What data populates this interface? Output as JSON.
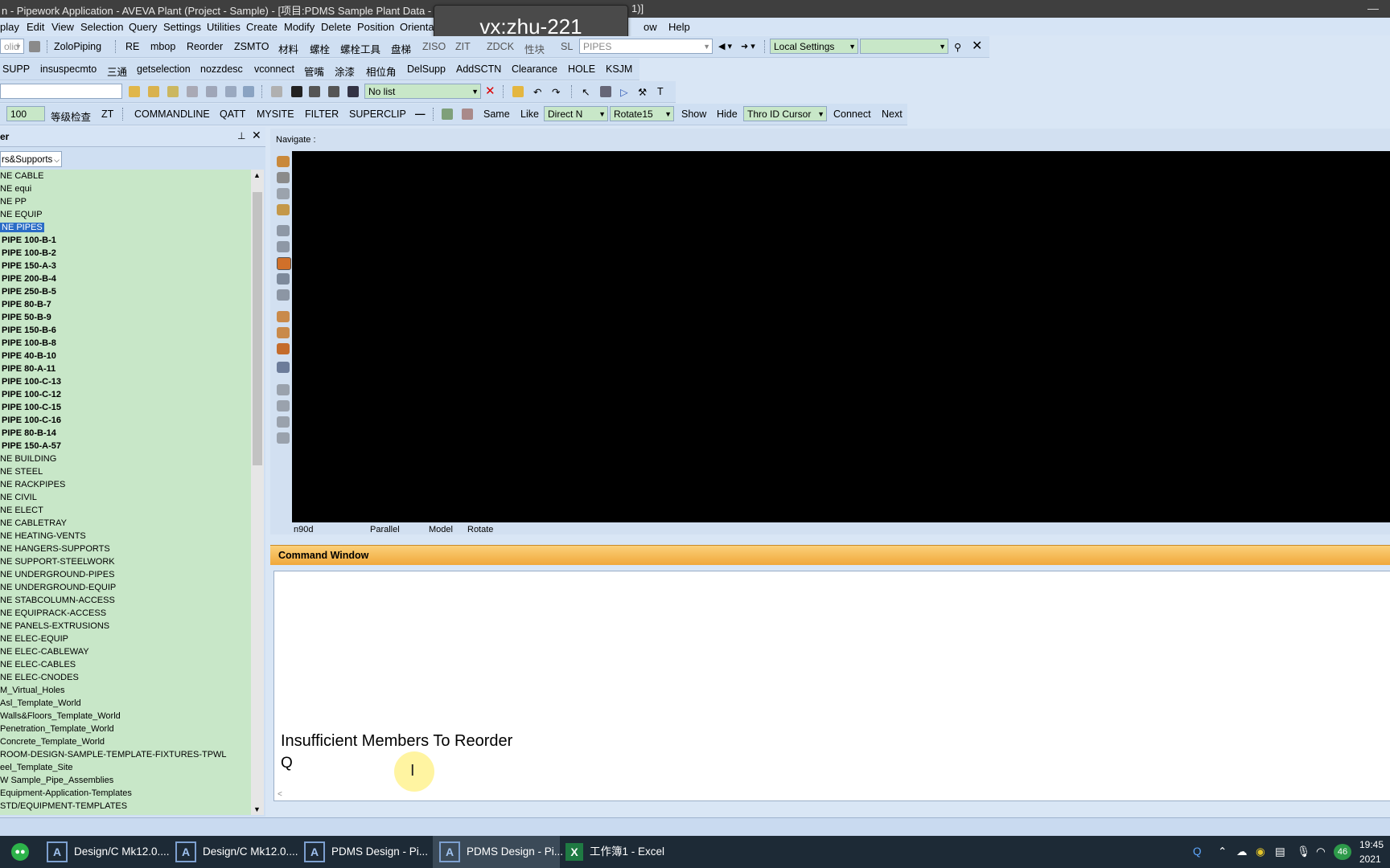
{
  "window": {
    "title": "n - Pipework Application -  AVEVA Plant (Project - Sample) - [项目:PDMS Sample Plant Data - ",
    "title_tail": "1)]",
    "minimize_glyph": "—"
  },
  "overlay": {
    "text": "vx:zhu-221"
  },
  "menu": {
    "items": [
      "play",
      "Edit",
      "View",
      "Selection",
      "Query",
      "Settings",
      "Utilities",
      "Create",
      "Modify",
      "Delete",
      "Position",
      "Orienta",
      "ow",
      "Help"
    ]
  },
  "toolbar1": {
    "left_combo": "olid",
    "buttons": [
      "ZoloPiping",
      "RE",
      "mbop",
      "Reorder",
      "ZSMTO",
      "材料",
      "螺栓",
      "螺栓工具",
      "盘梯",
      "ZISO",
      "ZIT",
      "ZDCK",
      "性块",
      "SL"
    ],
    "pipe_combo": "PIPES",
    "settings_combo": "Local Settings",
    "blank_combo": ""
  },
  "toolbar2": {
    "buttons": [
      "SUPP",
      "insuspecmto",
      "三通",
      "getselection",
      "nozzdesc",
      "vconnect",
      "管嘴",
      "涂漆",
      "相位角",
      "DelSupp",
      "AddSCTN",
      "Clearance",
      "HOLE",
      "KSJM"
    ]
  },
  "toolbar3": {
    "list_combo": "No list"
  },
  "toolbar4": {
    "value_field": "100",
    "buttons": [
      "等级检查",
      "ZT",
      "COMMANDLINE",
      "QATT",
      "MYSITE",
      "FILTER",
      "SUPERCLIP",
      "—",
      "Same",
      "Like"
    ],
    "direct_combo": "Direct N",
    "rotate_combo": "Rotate15",
    "buttons2": [
      "Show",
      "Hide"
    ],
    "cursor_combo": "Thro ID Cursor",
    "buttons3": [
      "Connect",
      "Next"
    ]
  },
  "explorer": {
    "title": "er",
    "filter_value": "rs&Supports",
    "items": [
      {
        "label": "NE CABLE",
        "bold": false,
        "selected": false
      },
      {
        "label": "NE equi",
        "bold": false,
        "selected": false
      },
      {
        "label": "NE PP",
        "bold": false,
        "selected": false
      },
      {
        "label": "NE EQUIP",
        "bold": false,
        "selected": false
      },
      {
        "label": "NE PIPES",
        "bold": false,
        "selected": true
      },
      {
        "label": "PIPE 100-B-1",
        "bold": true,
        "selected": false
      },
      {
        "label": "PIPE 100-B-2",
        "bold": true,
        "selected": false
      },
      {
        "label": "PIPE 150-A-3",
        "bold": true,
        "selected": false
      },
      {
        "label": "PIPE 200-B-4",
        "bold": true,
        "selected": false
      },
      {
        "label": "PIPE 250-B-5",
        "bold": true,
        "selected": false
      },
      {
        "label": "PIPE 80-B-7",
        "bold": true,
        "selected": false
      },
      {
        "label": "PIPE 50-B-9",
        "bold": true,
        "selected": false
      },
      {
        "label": "PIPE 150-B-6",
        "bold": true,
        "selected": false
      },
      {
        "label": "PIPE 100-B-8",
        "bold": true,
        "selected": false
      },
      {
        "label": "PIPE 40-B-10",
        "bold": true,
        "selected": false
      },
      {
        "label": "PIPE 80-A-11",
        "bold": true,
        "selected": false
      },
      {
        "label": "PIPE 100-C-13",
        "bold": true,
        "selected": false
      },
      {
        "label": "PIPE 100-C-12",
        "bold": true,
        "selected": false
      },
      {
        "label": "PIPE 100-C-15",
        "bold": true,
        "selected": false
      },
      {
        "label": "PIPE 100-C-16",
        "bold": true,
        "selected": false
      },
      {
        "label": "PIPE 80-B-14",
        "bold": true,
        "selected": false
      },
      {
        "label": "PIPE 150-A-57",
        "bold": true,
        "selected": false
      },
      {
        "label": "NE BUILDING",
        "bold": false,
        "selected": false
      },
      {
        "label": "NE STEEL",
        "bold": false,
        "selected": false
      },
      {
        "label": "NE RACKPIPES",
        "bold": false,
        "selected": false
      },
      {
        "label": "NE CIVIL",
        "bold": false,
        "selected": false
      },
      {
        "label": "NE ELECT",
        "bold": false,
        "selected": false
      },
      {
        "label": "NE CABLETRAY",
        "bold": false,
        "selected": false
      },
      {
        "label": "NE HEATING-VENTS",
        "bold": false,
        "selected": false
      },
      {
        "label": "NE HANGERS-SUPPORTS",
        "bold": false,
        "selected": false
      },
      {
        "label": "NE SUPPORT-STEELWORK",
        "bold": false,
        "selected": false
      },
      {
        "label": "NE UNDERGROUND-PIPES",
        "bold": false,
        "selected": false
      },
      {
        "label": "NE UNDERGROUND-EQUIP",
        "bold": false,
        "selected": false
      },
      {
        "label": "NE STABCOLUMN-ACCESS",
        "bold": false,
        "selected": false
      },
      {
        "label": "NE EQUIPRACK-ACCESS",
        "bold": false,
        "selected": false
      },
      {
        "label": "NE PANELS-EXTRUSIONS",
        "bold": false,
        "selected": false
      },
      {
        "label": "NE ELEC-EQUIP",
        "bold": false,
        "selected": false
      },
      {
        "label": "NE ELEC-CABLEWAY",
        "bold": false,
        "selected": false
      },
      {
        "label": "NE ELEC-CABLES",
        "bold": false,
        "selected": false
      },
      {
        "label": "NE ELEC-CNODES",
        "bold": false,
        "selected": false
      },
      {
        "label": "M_Virtual_Holes",
        "bold": false,
        "selected": false
      },
      {
        "label": "Asl_Template_World",
        "bold": false,
        "selected": false
      },
      {
        "label": "Walls&Floors_Template_World",
        "bold": false,
        "selected": false
      },
      {
        "label": "Penetration_Template_World",
        "bold": false,
        "selected": false
      },
      {
        "label": "Concrete_Template_World",
        "bold": false,
        "selected": false
      },
      {
        "label": "ROOM-DESIGN-SAMPLE-TEMPLATE-FIXTURES-TPWL",
        "bold": false,
        "selected": false
      },
      {
        "label": "eel_Template_Site",
        "bold": false,
        "selected": false
      },
      {
        "label": "W Sample_Pipe_Assemblies",
        "bold": false,
        "selected": false
      },
      {
        "label": "Equipment-Application-Templates",
        "bold": false,
        "selected": false
      },
      {
        "label": "STD/EQUIPMENT-TEMPLATES",
        "bold": false,
        "selected": false
      }
    ]
  },
  "viewport": {
    "nav_label": "Navigate :",
    "status": [
      "n90d",
      "Parallel",
      "Model",
      "Rotate"
    ]
  },
  "command_window": {
    "title": "Command Window",
    "message": "Insufficient Members To Reorder",
    "prompt": "Q"
  },
  "taskbar": {
    "items": [
      {
        "label": "Design/C Mk12.0....",
        "active": false
      },
      {
        "label": "Design/C Mk12.0....",
        "active": false
      },
      {
        "label": "PDMS Design - Pi...",
        "active": false
      },
      {
        "label": "PDMS Design - Pi...",
        "active": true
      },
      {
        "label": "工作簿1 - Excel",
        "active": false
      }
    ],
    "clock_time": "19:45",
    "clock_date": "2021",
    "badge": "46"
  },
  "colors": {
    "accent_selected": "#2a6cc6",
    "tree_bg": "#c8e7c8",
    "command_header": "#f0a83a"
  }
}
